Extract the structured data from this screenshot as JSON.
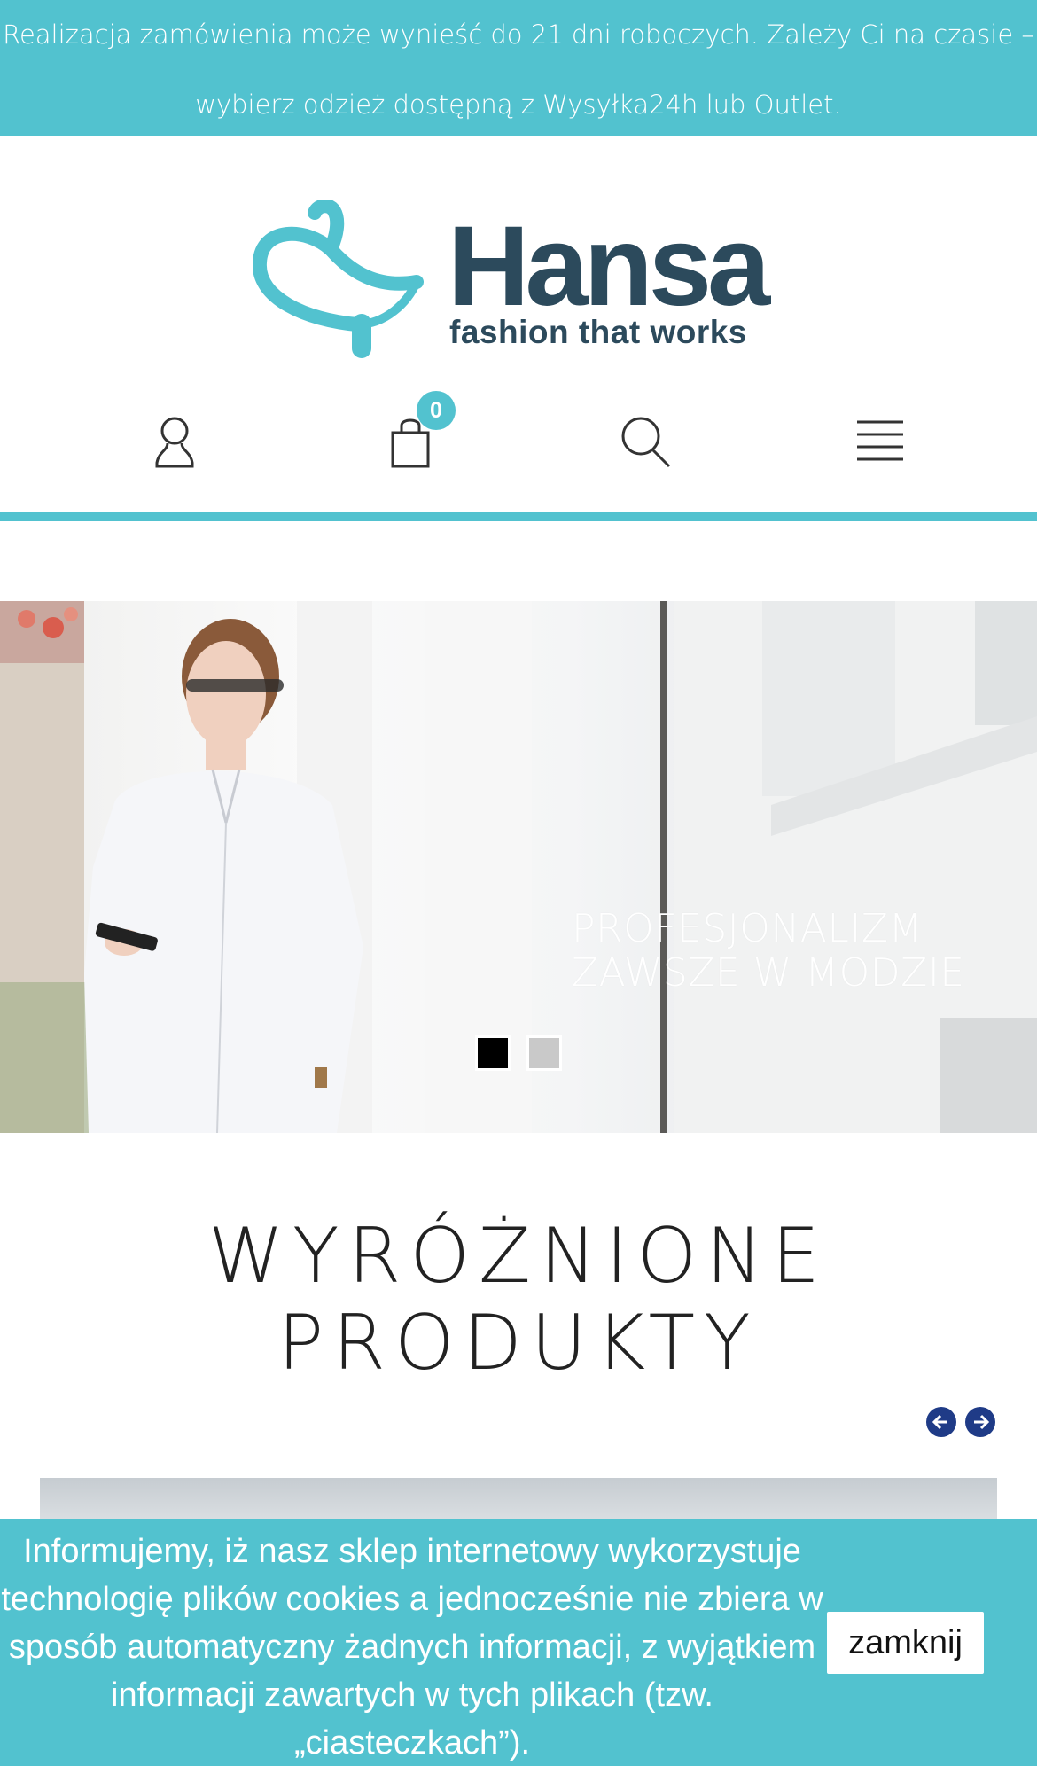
{
  "announcement": {
    "line1": "Realizacja zamówienia może wynieść do 21 dni roboczych. Zależy Ci na czasie –",
    "line2": "wybierz odzież dostępną z Wysyłka24h lub Outlet."
  },
  "brand": {
    "name": "Hansa",
    "tagline": "fashion that works",
    "primary_color": "#2c4a5c",
    "accent_color": "#52c2cf"
  },
  "header_icons": {
    "account": "user-icon",
    "cart": "shopping-bag-icon",
    "cart_count": "0",
    "search": "search-icon",
    "menu": "hamburger-menu-icon"
  },
  "slider": {
    "headline_line1": "PROFESJONALIZM",
    "headline_line2": "ZAWSZE W MODZIE",
    "slides_count": 2,
    "active_slide": 1
  },
  "featured": {
    "title_line1": "WYRÓŻNIONE",
    "title_line2": "PRODUKTY"
  },
  "cookie_notice": {
    "text": "Informujemy, iż nasz sklep internetowy wykorzystuje technologię plików cookies a jednocześnie nie zbiera w sposób automatyczny żadnych informacji, z wyjątkiem informacji zawartych w tych plikach (tzw. „ciasteczkach”).",
    "close_label": "zamknij"
  }
}
